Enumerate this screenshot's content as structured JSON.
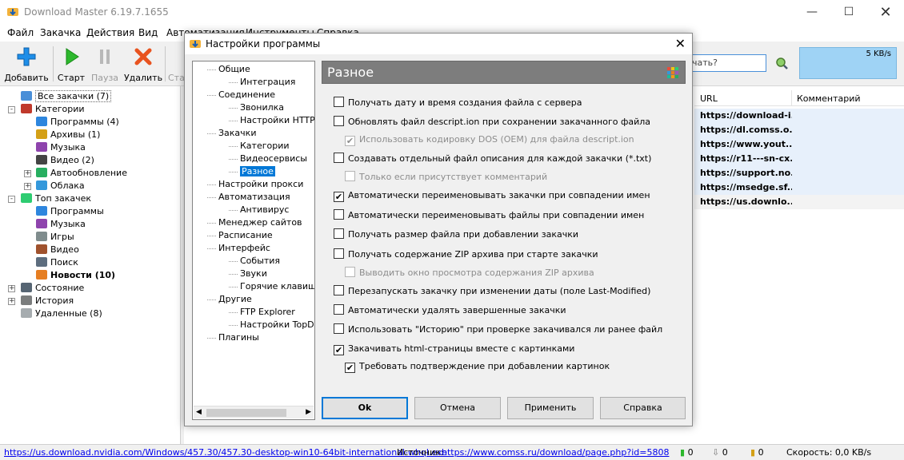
{
  "window": {
    "title": "Download Master 6.19.7.1655"
  },
  "menu": [
    "Файл",
    "Закачка",
    "Действия",
    "Вид",
    "Автоматизация",
    "Инструменты",
    "Справка"
  ],
  "toolbar": {
    "add": "Добавить",
    "start": "Старт",
    "pause": "Пауза",
    "delete": "Удалить",
    "start_all": "Ста"
  },
  "search": {
    "placeholder": "чать?"
  },
  "speed": {
    "value": "5 KB/s"
  },
  "left_tree": [
    {
      "label": "Все закачки (7)",
      "indent": 0,
      "pm": "",
      "icon": "#4a8fd8",
      "bold": false
    },
    {
      "label": "Категории",
      "indent": 0,
      "pm": "-",
      "icon": "#c0392b",
      "bold": false
    },
    {
      "label": "Программы (4)",
      "indent": 1,
      "pm": "",
      "icon": "#2e86de",
      "bold": false
    },
    {
      "label": "Архивы (1)",
      "indent": 1,
      "pm": "",
      "icon": "#d4a017",
      "bold": false
    },
    {
      "label": "Музыка",
      "indent": 1,
      "pm": "",
      "icon": "#8e44ad",
      "bold": false
    },
    {
      "label": "Видео (2)",
      "indent": 1,
      "pm": "",
      "icon": "#444444",
      "bold": false
    },
    {
      "label": "Автообновление",
      "indent": 1,
      "pm": "+",
      "icon": "#27ae60",
      "bold": false
    },
    {
      "label": "Облака",
      "indent": 1,
      "pm": "+",
      "icon": "#3498db",
      "bold": false
    },
    {
      "label": "Топ закачек",
      "indent": 0,
      "pm": "-",
      "icon": "#2ecc71",
      "bold": false
    },
    {
      "label": "Программы",
      "indent": 1,
      "pm": "",
      "icon": "#2e86de",
      "bold": false
    },
    {
      "label": "Музыка",
      "indent": 1,
      "pm": "",
      "icon": "#8e44ad",
      "bold": false
    },
    {
      "label": "Игры",
      "indent": 1,
      "pm": "",
      "icon": "#7f8c8d",
      "bold": false
    },
    {
      "label": "Видео",
      "indent": 1,
      "pm": "",
      "icon": "#a0522d",
      "bold": false
    },
    {
      "label": "Поиск",
      "indent": 1,
      "pm": "",
      "icon": "#5d6d7e",
      "bold": false
    },
    {
      "label": "Новости (10)",
      "indent": 1,
      "pm": "",
      "icon": "#e67e22",
      "bold": true
    },
    {
      "label": "Состояние",
      "indent": 0,
      "pm": "+",
      "icon": "#566573",
      "bold": false
    },
    {
      "label": "История",
      "indent": 0,
      "pm": "+",
      "icon": "#7b7d7d",
      "bold": false
    },
    {
      "label": "Удаленные (8)",
      "indent": 0,
      "pm": "",
      "icon": "#a6acaf",
      "bold": false
    }
  ],
  "list": {
    "columns": [
      "URL",
      "Комментарий"
    ],
    "urls": [
      "https://download-i...",
      "https://dl.comss.o...",
      "https://www.yout...",
      "https://r11---sn-cx...",
      "https://support.no...",
      "https://msedge.sf...",
      "https://us.downlo..."
    ]
  },
  "status": {
    "url": "https://us.download.nvidia.com/Windows/457.30/457.30-desktop-win10-64bit-international-whql.exe",
    "source_label": "Источник:",
    "source_url": "https://www.comss.ru/download/page.php?id=5808",
    "count_active": "0",
    "count_down": "0",
    "count_files": "0",
    "speed": "Скорость: 0,0 KB/s"
  },
  "dialog": {
    "title": "Настройки программы",
    "nav": [
      {
        "label": "Общие",
        "level": 0
      },
      {
        "label": "Интеграция",
        "level": 1
      },
      {
        "label": "Соединение",
        "level": 0
      },
      {
        "label": "Звонилка",
        "level": 1
      },
      {
        "label": "Настройки HTTP/F",
        "level": 1
      },
      {
        "label": "Закачки",
        "level": 0
      },
      {
        "label": "Категории",
        "level": 1
      },
      {
        "label": "Видеосервисы",
        "level": 1
      },
      {
        "label": "Разное",
        "level": 1,
        "selected": true
      },
      {
        "label": "Настройки прокси",
        "level": 0
      },
      {
        "label": "Автоматизация",
        "level": 0
      },
      {
        "label": "Антивирус",
        "level": 1
      },
      {
        "label": "Менеджер сайтов",
        "level": 0
      },
      {
        "label": "Расписание",
        "level": 0
      },
      {
        "label": "Интерфейс",
        "level": 0
      },
      {
        "label": "События",
        "level": 1
      },
      {
        "label": "Звуки",
        "level": 1
      },
      {
        "label": "Горячие клавиши",
        "level": 1
      },
      {
        "label": "Другие",
        "level": 0
      },
      {
        "label": "FTP Explorer",
        "level": 1
      },
      {
        "label": "Настройки TopDov",
        "level": 1
      },
      {
        "label": "Плагины",
        "level": 0
      }
    ],
    "section_title": "Разное",
    "options": [
      {
        "label": "Получать дату и время создания файла с сервера",
        "checked": false,
        "disabled": false,
        "indent": 0
      },
      {
        "label": "Обновлять файл descript.ion при сохранении закачанного файла",
        "checked": false,
        "disabled": false,
        "indent": 0
      },
      {
        "label": "Использовать кодировку DOS (OEM) для файла descript.ion",
        "checked": true,
        "disabled": true,
        "indent": 1
      },
      {
        "label": "Создавать отдельный файл описания для каждой закачки (*.txt)",
        "checked": false,
        "disabled": false,
        "indent": 0
      },
      {
        "label": "Только если присутствует комментарий",
        "checked": false,
        "disabled": true,
        "indent": 1
      },
      {
        "label": "Автоматически переименовывать закачки при совпадении имен",
        "checked": true,
        "disabled": false,
        "indent": 0
      },
      {
        "label": "Автоматически переименовывать файлы при совпадении имен",
        "checked": false,
        "disabled": false,
        "indent": 0
      },
      {
        "label": "Получать размер файла при добавлении закачки",
        "checked": false,
        "disabled": false,
        "indent": 0
      },
      {
        "label": "Получать содержание ZIP архива при старте закачки",
        "checked": false,
        "disabled": false,
        "indent": 0
      },
      {
        "label": "Выводить окно просмотра содержания ZIP архива",
        "checked": false,
        "disabled": true,
        "indent": 1
      },
      {
        "label": "Перезапускать закачку при изменении даты (поле Last-Modified)",
        "checked": false,
        "disabled": false,
        "indent": 0
      },
      {
        "label": "Автоматически удалять завершенные закачки",
        "checked": false,
        "disabled": false,
        "indent": 0
      },
      {
        "label": "Использовать \"Историю\" при проверке закачивался ли ранее файл",
        "checked": false,
        "disabled": false,
        "indent": 0
      },
      {
        "label": "Закачивать html-страницы вместе с картинками",
        "checked": true,
        "disabled": false,
        "indent": 0
      },
      {
        "label": "Требовать подтверждение при добавлении картинок",
        "checked": true,
        "disabled": false,
        "indent": 1
      }
    ],
    "buttons": {
      "ok": "Ok",
      "cancel": "Отмена",
      "apply": "Применить",
      "help": "Справка"
    }
  },
  "colors": {
    "accent": "#0078d7",
    "speed_graph": "#9fd3f5",
    "section_header": "#7d7d7d"
  }
}
